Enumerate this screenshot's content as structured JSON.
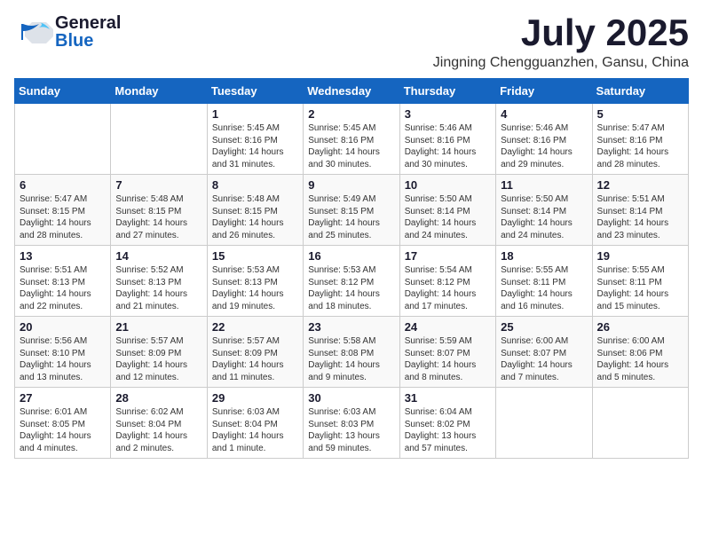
{
  "header": {
    "logo_general": "General",
    "logo_blue": "Blue",
    "month": "July 2025",
    "location": "Jingning Chengguanzhen, Gansu, China"
  },
  "days_of_week": [
    "Sunday",
    "Monday",
    "Tuesday",
    "Wednesday",
    "Thursday",
    "Friday",
    "Saturday"
  ],
  "weeks": [
    [
      {
        "day": "",
        "info": ""
      },
      {
        "day": "",
        "info": ""
      },
      {
        "day": "1",
        "info": "Sunrise: 5:45 AM\nSunset: 8:16 PM\nDaylight: 14 hours\nand 31 minutes."
      },
      {
        "day": "2",
        "info": "Sunrise: 5:45 AM\nSunset: 8:16 PM\nDaylight: 14 hours\nand 30 minutes."
      },
      {
        "day": "3",
        "info": "Sunrise: 5:46 AM\nSunset: 8:16 PM\nDaylight: 14 hours\nand 30 minutes."
      },
      {
        "day": "4",
        "info": "Sunrise: 5:46 AM\nSunset: 8:16 PM\nDaylight: 14 hours\nand 29 minutes."
      },
      {
        "day": "5",
        "info": "Sunrise: 5:47 AM\nSunset: 8:16 PM\nDaylight: 14 hours\nand 28 minutes."
      }
    ],
    [
      {
        "day": "6",
        "info": "Sunrise: 5:47 AM\nSunset: 8:15 PM\nDaylight: 14 hours\nand 28 minutes."
      },
      {
        "day": "7",
        "info": "Sunrise: 5:48 AM\nSunset: 8:15 PM\nDaylight: 14 hours\nand 27 minutes."
      },
      {
        "day": "8",
        "info": "Sunrise: 5:48 AM\nSunset: 8:15 PM\nDaylight: 14 hours\nand 26 minutes."
      },
      {
        "day": "9",
        "info": "Sunrise: 5:49 AM\nSunset: 8:15 PM\nDaylight: 14 hours\nand 25 minutes."
      },
      {
        "day": "10",
        "info": "Sunrise: 5:50 AM\nSunset: 8:14 PM\nDaylight: 14 hours\nand 24 minutes."
      },
      {
        "day": "11",
        "info": "Sunrise: 5:50 AM\nSunset: 8:14 PM\nDaylight: 14 hours\nand 24 minutes."
      },
      {
        "day": "12",
        "info": "Sunrise: 5:51 AM\nSunset: 8:14 PM\nDaylight: 14 hours\nand 23 minutes."
      }
    ],
    [
      {
        "day": "13",
        "info": "Sunrise: 5:51 AM\nSunset: 8:13 PM\nDaylight: 14 hours\nand 22 minutes."
      },
      {
        "day": "14",
        "info": "Sunrise: 5:52 AM\nSunset: 8:13 PM\nDaylight: 14 hours\nand 21 minutes."
      },
      {
        "day": "15",
        "info": "Sunrise: 5:53 AM\nSunset: 8:13 PM\nDaylight: 14 hours\nand 19 minutes."
      },
      {
        "day": "16",
        "info": "Sunrise: 5:53 AM\nSunset: 8:12 PM\nDaylight: 14 hours\nand 18 minutes."
      },
      {
        "day": "17",
        "info": "Sunrise: 5:54 AM\nSunset: 8:12 PM\nDaylight: 14 hours\nand 17 minutes."
      },
      {
        "day": "18",
        "info": "Sunrise: 5:55 AM\nSunset: 8:11 PM\nDaylight: 14 hours\nand 16 minutes."
      },
      {
        "day": "19",
        "info": "Sunrise: 5:55 AM\nSunset: 8:11 PM\nDaylight: 14 hours\nand 15 minutes."
      }
    ],
    [
      {
        "day": "20",
        "info": "Sunrise: 5:56 AM\nSunset: 8:10 PM\nDaylight: 14 hours\nand 13 minutes."
      },
      {
        "day": "21",
        "info": "Sunrise: 5:57 AM\nSunset: 8:09 PM\nDaylight: 14 hours\nand 12 minutes."
      },
      {
        "day": "22",
        "info": "Sunrise: 5:57 AM\nSunset: 8:09 PM\nDaylight: 14 hours\nand 11 minutes."
      },
      {
        "day": "23",
        "info": "Sunrise: 5:58 AM\nSunset: 8:08 PM\nDaylight: 14 hours\nand 9 minutes."
      },
      {
        "day": "24",
        "info": "Sunrise: 5:59 AM\nSunset: 8:07 PM\nDaylight: 14 hours\nand 8 minutes."
      },
      {
        "day": "25",
        "info": "Sunrise: 6:00 AM\nSunset: 8:07 PM\nDaylight: 14 hours\nand 7 minutes."
      },
      {
        "day": "26",
        "info": "Sunrise: 6:00 AM\nSunset: 8:06 PM\nDaylight: 14 hours\nand 5 minutes."
      }
    ],
    [
      {
        "day": "27",
        "info": "Sunrise: 6:01 AM\nSunset: 8:05 PM\nDaylight: 14 hours\nand 4 minutes."
      },
      {
        "day": "28",
        "info": "Sunrise: 6:02 AM\nSunset: 8:04 PM\nDaylight: 14 hours\nand 2 minutes."
      },
      {
        "day": "29",
        "info": "Sunrise: 6:03 AM\nSunset: 8:04 PM\nDaylight: 14 hours\nand 1 minute."
      },
      {
        "day": "30",
        "info": "Sunrise: 6:03 AM\nSunset: 8:03 PM\nDaylight: 13 hours\nand 59 minutes."
      },
      {
        "day": "31",
        "info": "Sunrise: 6:04 AM\nSunset: 8:02 PM\nDaylight: 13 hours\nand 57 minutes."
      },
      {
        "day": "",
        "info": ""
      },
      {
        "day": "",
        "info": ""
      }
    ]
  ]
}
